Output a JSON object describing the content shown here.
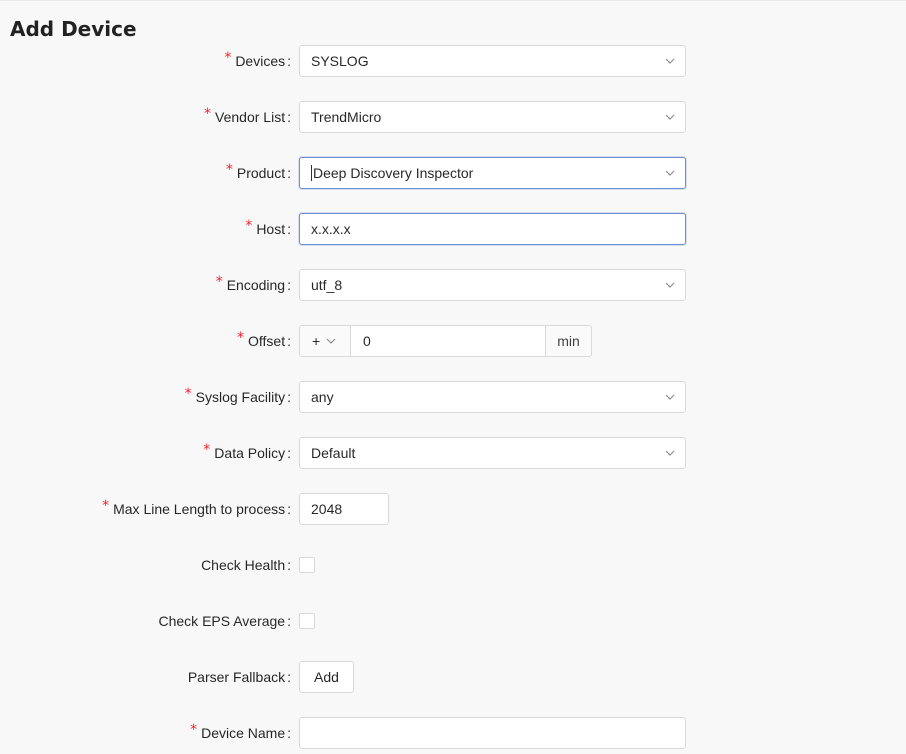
{
  "page": {
    "title": "Add Device"
  },
  "form": {
    "devices": {
      "label": "Devices",
      "value": "SYSLOG"
    },
    "vendor_list": {
      "label": "Vendor List",
      "value": "TrendMicro"
    },
    "product": {
      "label": "Product",
      "value": "Deep Discovery Inspector"
    },
    "host": {
      "label": "Host",
      "value": "x.x.x.x"
    },
    "encoding": {
      "label": "Encoding",
      "value": "utf_8"
    },
    "offset": {
      "label": "Offset",
      "sign": "+",
      "value": "0",
      "unit": "min"
    },
    "syslog_facility": {
      "label": "Syslog Facility",
      "value": "any"
    },
    "data_policy": {
      "label": "Data Policy",
      "value": "Default"
    },
    "max_line_length": {
      "label": "Max Line Length to process",
      "value": "2048"
    },
    "check_health": {
      "label": "Check Health",
      "checked": false
    },
    "check_eps_average": {
      "label": "Check EPS Average",
      "checked": false
    },
    "parser_fallback": {
      "label": "Parser Fallback",
      "button_label": "Add"
    },
    "device_name": {
      "label": "Device Name",
      "value": ""
    },
    "required_mark": "*",
    "colon": ":"
  },
  "colors": {
    "required": "#f5222d",
    "focus_border": "#6c8fd6",
    "border": "#d9d9d9"
  },
  "icons": {
    "dropdown": "chevron-down-icon"
  }
}
